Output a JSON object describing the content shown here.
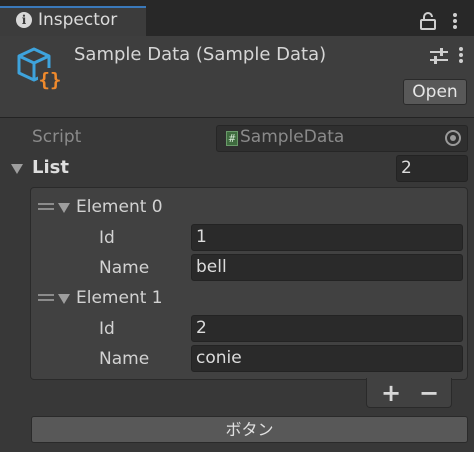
{
  "tab": {
    "title": "Inspector",
    "info_glyph": "i"
  },
  "header": {
    "title": "Sample Data (Sample Data)",
    "open_label": "Open"
  },
  "script": {
    "label": "Script",
    "value": "SampleData",
    "hash": "#"
  },
  "list": {
    "label": "List",
    "size": "2",
    "elements": [
      {
        "label": "Element 0",
        "id_label": "Id",
        "id_value": "1",
        "name_label": "Name",
        "name_value": "bell"
      },
      {
        "label": "Element 1",
        "id_label": "Id",
        "id_value": "2",
        "name_label": "Name",
        "name_value": "conie"
      }
    ],
    "add_label": "+",
    "remove_label": "−"
  },
  "action": {
    "button_label": "ボタン"
  },
  "colors": {
    "accent": "#3a79bb",
    "asset_icon_blue": "#3ea3dc",
    "asset_icon_orange": "#f08a2c"
  }
}
